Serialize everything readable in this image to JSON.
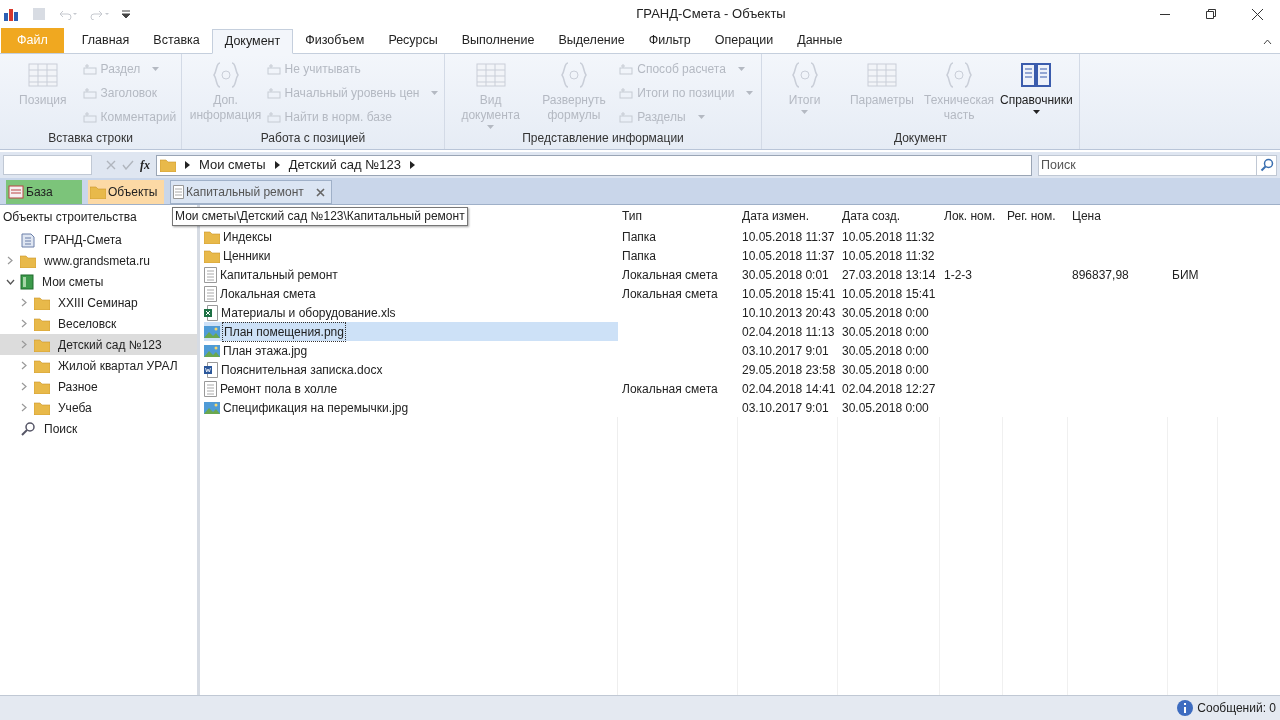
{
  "window": {
    "title": "ГРАНД-Смета - Объекты"
  },
  "ribbon_tabs": [
    {
      "label": "Файл",
      "kind": "file",
      "selected": false
    },
    {
      "label": "Главная",
      "kind": "tab",
      "selected": false
    },
    {
      "label": "Вставка",
      "kind": "tab",
      "selected": false
    },
    {
      "label": "Документ",
      "kind": "tab",
      "selected": true
    },
    {
      "label": "Физобъем",
      "kind": "tab",
      "selected": false
    },
    {
      "label": "Ресурсы",
      "kind": "tab",
      "selected": false
    },
    {
      "label": "Выполнение",
      "kind": "tab",
      "selected": false
    },
    {
      "label": "Выделение",
      "kind": "tab",
      "selected": false
    },
    {
      "label": "Фильтр",
      "kind": "tab",
      "selected": false
    },
    {
      "label": "Операции",
      "kind": "tab",
      "selected": false
    },
    {
      "label": "Данные",
      "kind": "tab",
      "selected": false
    }
  ],
  "ribbon_groups": [
    {
      "title": "Вставка строки",
      "items": [
        {
          "kind": "large",
          "label": "Позиция",
          "disabled": true,
          "dropdown": false
        },
        {
          "kind": "stack",
          "items": [
            {
              "label": "Раздел",
              "disabled": true,
              "dropdown": true
            },
            {
              "label": "Заголовок",
              "disabled": true,
              "dropdown": false
            },
            {
              "label": "Комментарий",
              "disabled": true,
              "dropdown": false
            }
          ]
        }
      ]
    },
    {
      "title": "Работа с позицией",
      "items": [
        {
          "kind": "large",
          "label": "Доп. информация",
          "disabled": true,
          "dropdown": false
        },
        {
          "kind": "stack",
          "items": [
            {
              "label": "Не учитывать",
              "disabled": true,
              "dropdown": false
            },
            {
              "label": "Начальный уровень цен",
              "disabled": true,
              "dropdown": true
            },
            {
              "label": "Найти в норм. базе",
              "disabled": true,
              "dropdown": false
            }
          ]
        }
      ]
    },
    {
      "title": "Представление информации",
      "items": [
        {
          "kind": "large",
          "label": "Вид документа",
          "disabled": true,
          "dropdown": true
        },
        {
          "kind": "large",
          "label": "Развернуть формулы",
          "disabled": true,
          "dropdown": false
        },
        {
          "kind": "stack",
          "items": [
            {
              "label": "Способ расчета",
              "disabled": true,
              "dropdown": true
            },
            {
              "label": "Итоги по позиции",
              "disabled": true,
              "dropdown": true
            },
            {
              "label": "Разделы",
              "disabled": true,
              "dropdown": true
            }
          ]
        }
      ]
    },
    {
      "title": "Документ",
      "items": [
        {
          "kind": "large",
          "label": "Итоги",
          "disabled": true,
          "dropdown": true
        },
        {
          "kind": "large",
          "label": "Параметры",
          "disabled": true,
          "dropdown": false
        },
        {
          "kind": "large",
          "label": "Техническая часть",
          "disabled": true,
          "dropdown": false
        },
        {
          "kind": "large",
          "label": "Справочники",
          "disabled": false,
          "dropdown": true
        }
      ]
    }
  ],
  "formula_bar": {
    "function_label": "fx"
  },
  "breadcrumb": [
    "Мои сметы",
    "Детский сад №123"
  ],
  "search": {
    "placeholder": "Поиск"
  },
  "doc_tabs": [
    {
      "label": "База",
      "color": "#7cc47a",
      "closable": false,
      "selected": false
    },
    {
      "label": "Объекты",
      "color": "#fcd9a5",
      "closable": false,
      "selected": false
    },
    {
      "label": "Капитальный ремонт",
      "color": "#dbe5f3",
      "closable": true,
      "selected": true
    }
  ],
  "sidebar": {
    "title": "Объекты строительства",
    "items": [
      {
        "label": "ГРАНД-Смета",
        "kind": "root",
        "selected": false
      },
      {
        "label": "www.grandsmeta.ru",
        "kind": "folder",
        "expanded": false,
        "selected": false
      },
      {
        "label": "Мои сметы",
        "kind": "book",
        "expanded": true,
        "selected": false,
        "children": [
          {
            "label": "XXIII Семинар",
            "kind": "folder",
            "expanded": false,
            "selected": false
          },
          {
            "label": "Веселовск",
            "kind": "folder",
            "expanded": false,
            "selected": false
          },
          {
            "label": "Детский сад №123",
            "kind": "folder",
            "expanded": false,
            "selected": true
          },
          {
            "label": "Жилой квартал УРАЛ",
            "kind": "folder",
            "expanded": false,
            "selected": false
          },
          {
            "label": "Разное",
            "kind": "folder",
            "expanded": false,
            "selected": false
          },
          {
            "label": "Учеба",
            "kind": "folder",
            "expanded": false,
            "selected": false
          }
        ]
      },
      {
        "label": "Поиск",
        "kind": "search",
        "selected": false
      }
    ]
  },
  "tooltip": "Мои сметы\\Детский сад №123\\Капитальный ремонт",
  "table": {
    "columns": [
      "Тип",
      "Дата измен.",
      "Дата созд.",
      "Лок. ном.",
      "Рег. ном.",
      "Цена"
    ],
    "rows": [
      {
        "kind": "folder",
        "name": "Индексы",
        "selected": false,
        "cells": [
          "Папка",
          "10.05.2018 11:37",
          "10.05.2018 11:32",
          "",
          "",
          "",
          ""
        ]
      },
      {
        "kind": "folder",
        "name": "Ценники",
        "selected": false,
        "cells": [
          "Папка",
          "10.05.2018 11:37",
          "10.05.2018 11:32",
          "",
          "",
          "",
          ""
        ]
      },
      {
        "kind": "estimate",
        "name": "Капитальный ремонт",
        "selected": false,
        "cells": [
          "Локальная смета",
          "30.05.2018 0:01",
          "27.03.2018 13:14",
          "1-2-3",
          "",
          "896837,98",
          "БИМ"
        ]
      },
      {
        "kind": "estimate",
        "name": "Локальная смета",
        "selected": false,
        "cells": [
          "Локальная смета",
          "10.05.2018 15:41",
          "10.05.2018 15:41",
          "",
          "",
          "",
          ""
        ]
      },
      {
        "kind": "excel",
        "name": "Материалы и оборудование.xls",
        "selected": false,
        "cells": [
          "",
          "10.10.2013 20:43",
          "30.05.2018 0:00",
          "",
          "",
          "",
          ""
        ]
      },
      {
        "kind": "image",
        "name": "План помещения.png",
        "selected": true,
        "cells": [
          "",
          "02.04.2018 11:13",
          "30.05.2018 0:00",
          "",
          "",
          "",
          ""
        ]
      },
      {
        "kind": "image",
        "name": "План этажа.jpg",
        "selected": false,
        "cells": [
          "",
          "03.10.2017 9:01",
          "30.05.2018 0:00",
          "",
          "",
          "",
          ""
        ]
      },
      {
        "kind": "word",
        "name": "Пояснительная записка.docx",
        "selected": false,
        "cells": [
          "",
          "29.05.2018 23:58",
          "30.05.2018 0:00",
          "",
          "",
          "",
          ""
        ]
      },
      {
        "kind": "estimate",
        "name": "Ремонт пола в холле",
        "selected": false,
        "cells": [
          "Локальная смета",
          "02.04.2018 14:41",
          "02.04.2018 12:27",
          "",
          "",
          "",
          ""
        ]
      },
      {
        "kind": "image",
        "name": "Спецификация на перемычки.jpg",
        "selected": false,
        "cells": [
          "",
          "03.10.2017 9:01",
          "30.05.2018 0:00",
          "",
          "",
          "",
          ""
        ]
      }
    ]
  },
  "status_bar": {
    "messages": "Сообщений: 0"
  }
}
